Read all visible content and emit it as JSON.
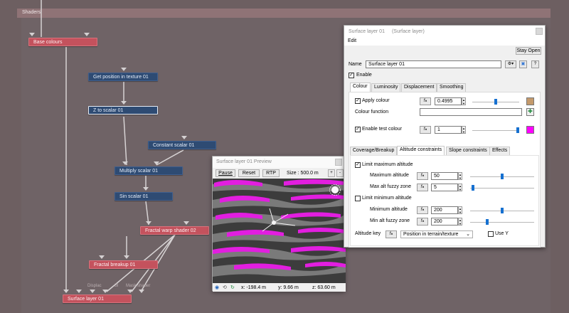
{
  "canvas": {
    "strip_label": "Shaders",
    "nodes": {
      "base_colours": "Base colours",
      "get_position": "Get position in texture 01",
      "z_to_scalar": "Z to scalar 01",
      "constant_scalar": "Constant scalar 01",
      "multiply_scalar": "Multiply scalar 01",
      "sin_scalar": "Sin scalar 01",
      "fractal_warp": "Fractal warp shader 02",
      "fractal_breakup": "Fractal breakup 01",
      "surface_layer": "Surface layer 01"
    },
    "input_labels": {
      "displace": "Displac",
      "blend": "Bl",
      "mask": "Mask shader"
    }
  },
  "preview": {
    "title": "Surface layer 01 Preview",
    "pause": "Pause",
    "reset": "Reset",
    "rtp": "RTP",
    "size": "Size : 500.0 m",
    "status": {
      "x": "x: -198.4 m",
      "y": "y: 9.66 m",
      "z": "z: 63.60 m"
    }
  },
  "editor": {
    "title": "Surface layer 01",
    "subtitle": "(Surface layer)",
    "menu_edit": "Edit",
    "stay_open": "Stay Open",
    "name_label": "Name",
    "name_value": "Surface layer 01",
    "enable_label": "Enable",
    "tabs": [
      "Colour",
      "Luminosity",
      "Displacement",
      "Smoothing"
    ],
    "apply_colour_label": "Apply colour",
    "apply_colour_value": "0.4995",
    "apply_colour_level": 0.5,
    "colour_function_label": "Colour function",
    "enable_test_colour_label": "Enable test colour",
    "test_colour_value": "1",
    "test_colour_level": 1.0,
    "subtabs": [
      "Coverage/Breakup",
      "Altitude constraints",
      "Slope constraints",
      "Effects"
    ],
    "limit_max_label": "Limit maximum altitude",
    "max_alt_label": "Maximum altitude",
    "max_alt_value": "50",
    "max_alt_level": 0.5,
    "max_fuzzy_label": "Max alt fuzzy zone",
    "max_fuzzy_value": "5",
    "max_fuzzy_level": 0.02,
    "limit_min_label": "Limit minimum altitude",
    "min_alt_label": "Minimum altitude",
    "min_alt_value": "200",
    "min_alt_level": 0.5,
    "min_fuzzy_label": "Min alt fuzzy zone",
    "min_fuzzy_value": "200",
    "min_fuzzy_level": 0.25,
    "altitude_key_label": "Altitude key",
    "altitude_key_value": "Position in terrain/texture",
    "use_y_label": "Use Y",
    "colors": {
      "apply_swatch": "#c49a6c",
      "test_swatch": "#ff00ff"
    }
  }
}
